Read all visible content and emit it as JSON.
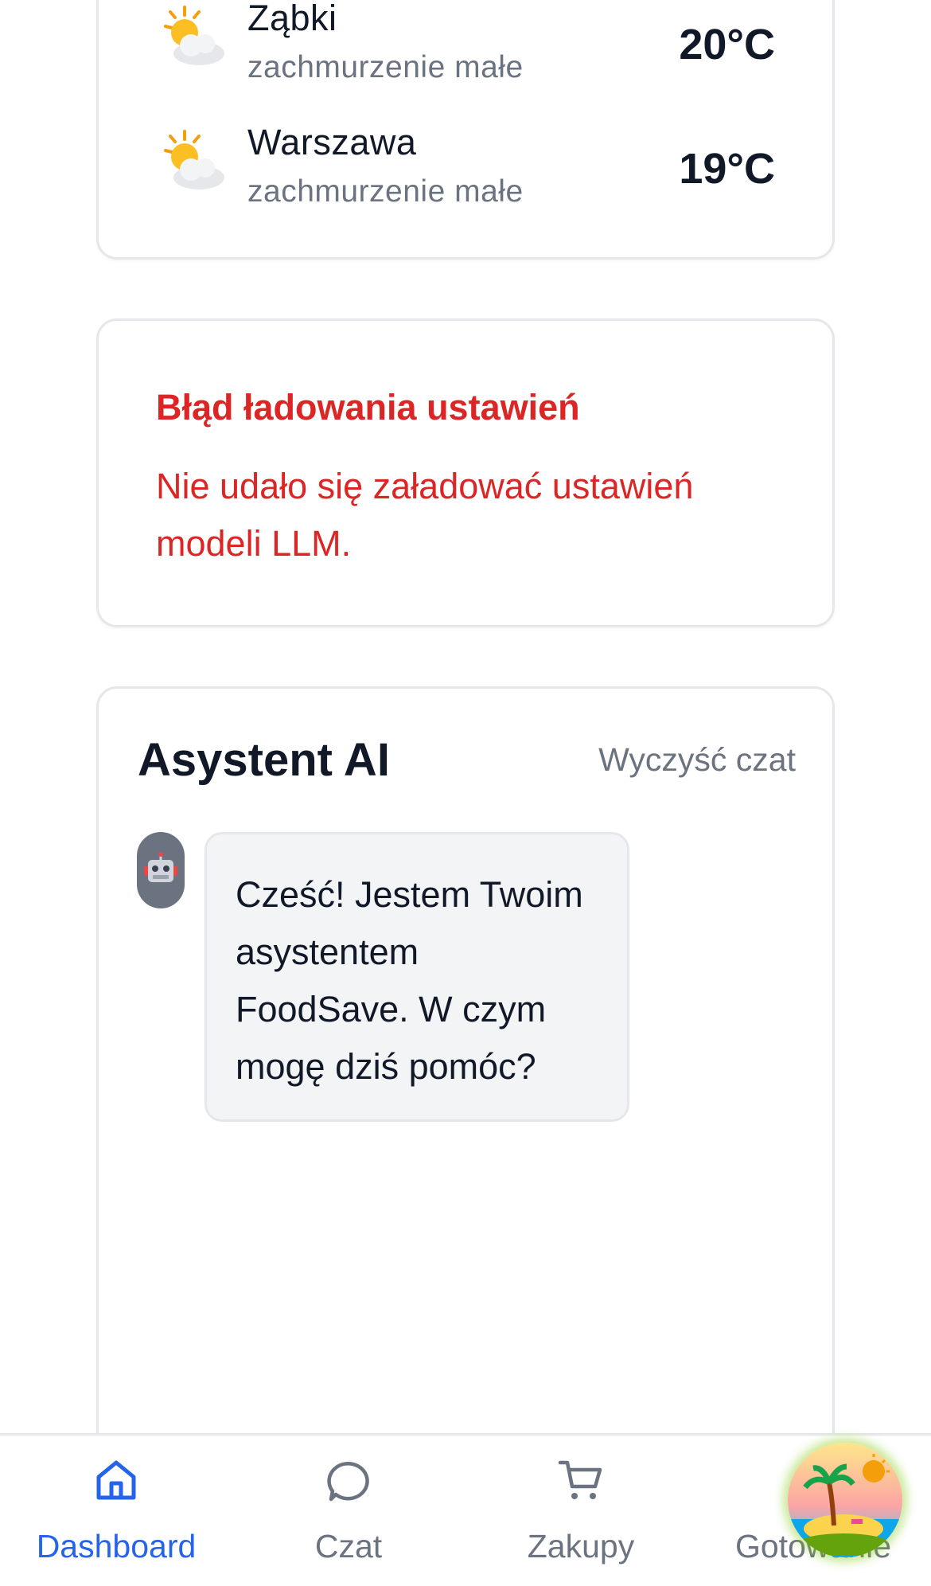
{
  "weather": {
    "rows": [
      {
        "city": "Ząbki",
        "description": "zachmurzenie małe",
        "temp": "20°C",
        "icon": "sun-behind-cloud-icon"
      },
      {
        "city": "Warszawa",
        "description": "zachmurzenie małe",
        "temp": "19°C",
        "icon": "sun-behind-cloud-icon"
      }
    ]
  },
  "error": {
    "title": "Błąd ładowania ustawień",
    "message": "Nie udało się załadować ustawień modeli LLM."
  },
  "chat": {
    "title": "Asystent AI",
    "clear_label": "Wyczyść czat",
    "bot_icon": "robot-icon",
    "messages": [
      {
        "role": "assistant",
        "text": "Cześć! Jestem Twoim asystentem FoodSave. W czym mogę dziś pomóc?"
      }
    ]
  },
  "nav": {
    "items": [
      {
        "label": "Dashboard",
        "icon": "home-icon",
        "active": true
      },
      {
        "label": "Czat",
        "icon": "chat-bubble-icon",
        "active": false
      },
      {
        "label": "Zakupy",
        "icon": "shopping-cart-icon",
        "active": false
      },
      {
        "label": "Gotowanie",
        "icon": "cooking-icon",
        "active": false
      }
    ],
    "fab_icon": "island-beach-icon"
  },
  "colors": {
    "accent": "#2563eb",
    "error": "#dc2626",
    "muted": "#6b7280",
    "border": "#e5e7eb"
  }
}
